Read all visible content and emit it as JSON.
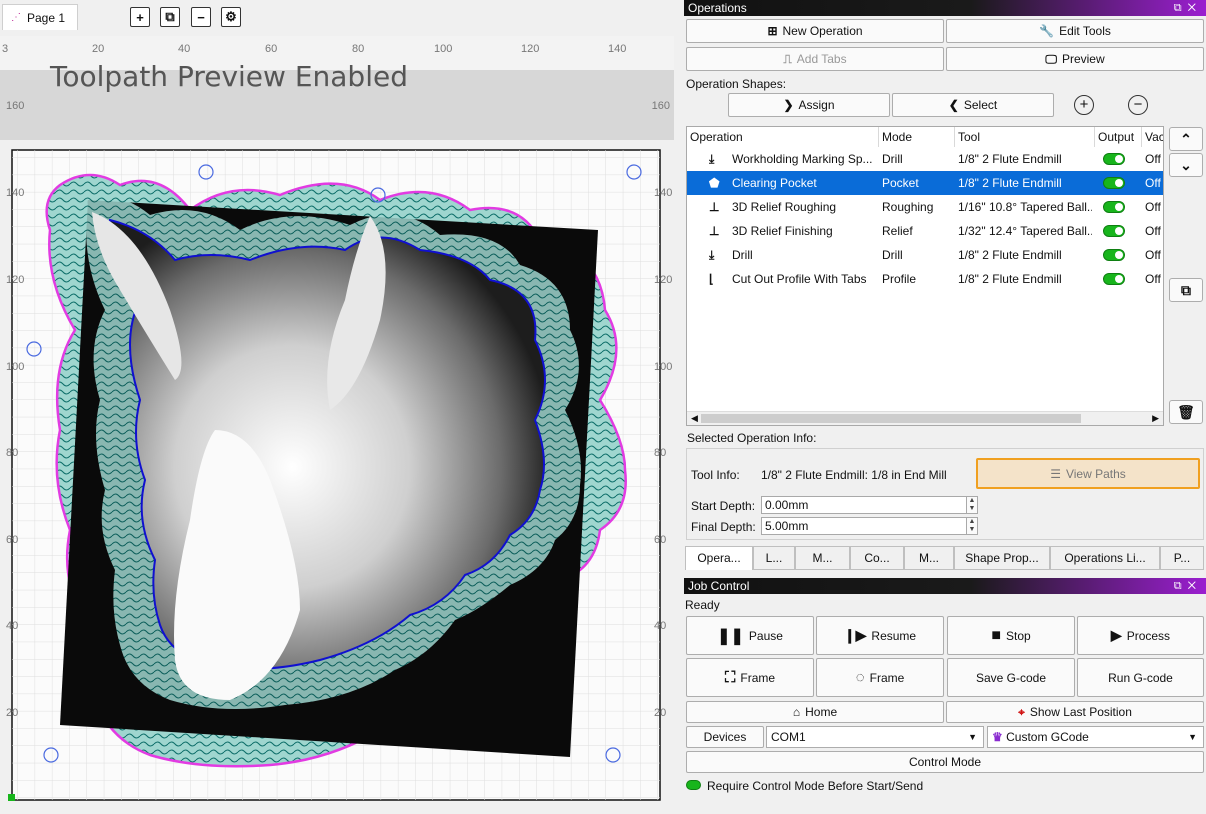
{
  "canvas": {
    "page_tab": "Page 1",
    "ruler_top": [
      "3",
      "20",
      "40",
      "60",
      "80",
      "100",
      "120",
      "140"
    ],
    "ruler_side_left": "160",
    "ruler_side_right": "160",
    "preview_banner": "Toolpath Preview Enabled",
    "y_ticks_left": [
      "140",
      "120",
      "100",
      "80",
      "60",
      "40",
      "20"
    ],
    "y_ticks_right": [
      "140",
      "120",
      "100",
      "80",
      "60",
      "40",
      "20"
    ]
  },
  "operations": {
    "title": "Operations",
    "new_operation": "New Operation",
    "edit_tools": "Edit Tools",
    "add_tabs": "Add Tabs",
    "preview": "Preview",
    "shapes_label": "Operation Shapes:",
    "assign": "Assign",
    "select": "Select",
    "columns": [
      "Operation",
      "Mode",
      "Tool",
      "Output",
      "Vacu"
    ],
    "rows": [
      {
        "name": "Workholding Marking Sp...",
        "mode": "Drill",
        "tool": "1/8\" 2 Flute Endmill",
        "vac": "Off"
      },
      {
        "name": "Clearing Pocket",
        "mode": "Pocket",
        "tool": "1/8\" 2 Flute Endmill",
        "vac": "Off"
      },
      {
        "name": "3D Relief Roughing",
        "mode": "Roughing",
        "tool": "1/16\" 10.8° Tapered Ball...",
        "vac": "Off"
      },
      {
        "name": "3D Relief Finishing",
        "mode": "Relief",
        "tool": "1/32\" 12.4° Tapered Ball...",
        "vac": "Off"
      },
      {
        "name": "Drill",
        "mode": "Drill",
        "tool": "1/8\" 2 Flute Endmill",
        "vac": "Off"
      },
      {
        "name": "Cut Out Profile With Tabs",
        "mode": "Profile",
        "tool": "1/8\" 2 Flute Endmill",
        "vac": "Off"
      }
    ],
    "info_label": "Selected Operation Info:",
    "tool_info_label": "Tool Info:",
    "tool_info_value": "1/8\" 2 Flute Endmill: 1/8 in End Mill",
    "view_paths": "View Paths",
    "start_depth_label": "Start Depth:",
    "start_depth": "0.00mm",
    "final_depth_label": "Final Depth:",
    "final_depth": "5.00mm",
    "bottom_tabs": [
      "Opera...",
      "L...",
      "M...",
      "Co...",
      "M...",
      "Shape Prop...",
      "Operations Li...",
      "P..."
    ]
  },
  "job": {
    "title": "Job Control",
    "status": "Ready",
    "pause": "Pause",
    "resume": "Resume",
    "stop": "Stop",
    "process": "Process",
    "frame1": "Frame",
    "frame2": "Frame",
    "save_gcode": "Save G-code",
    "run_gcode": "Run G-code",
    "home": "Home",
    "show_last": "Show Last Position",
    "devices": "Devices",
    "port": "COM1",
    "device": "Custom GCode",
    "control_mode": "Control Mode",
    "require_control": "Require Control Mode Before Start/Send"
  },
  "colors": {
    "accent": "#9b1fd0",
    "selection": "#0a6cd8",
    "toggle_on": "#18b51c",
    "view_paths_border": "#f0a020"
  }
}
